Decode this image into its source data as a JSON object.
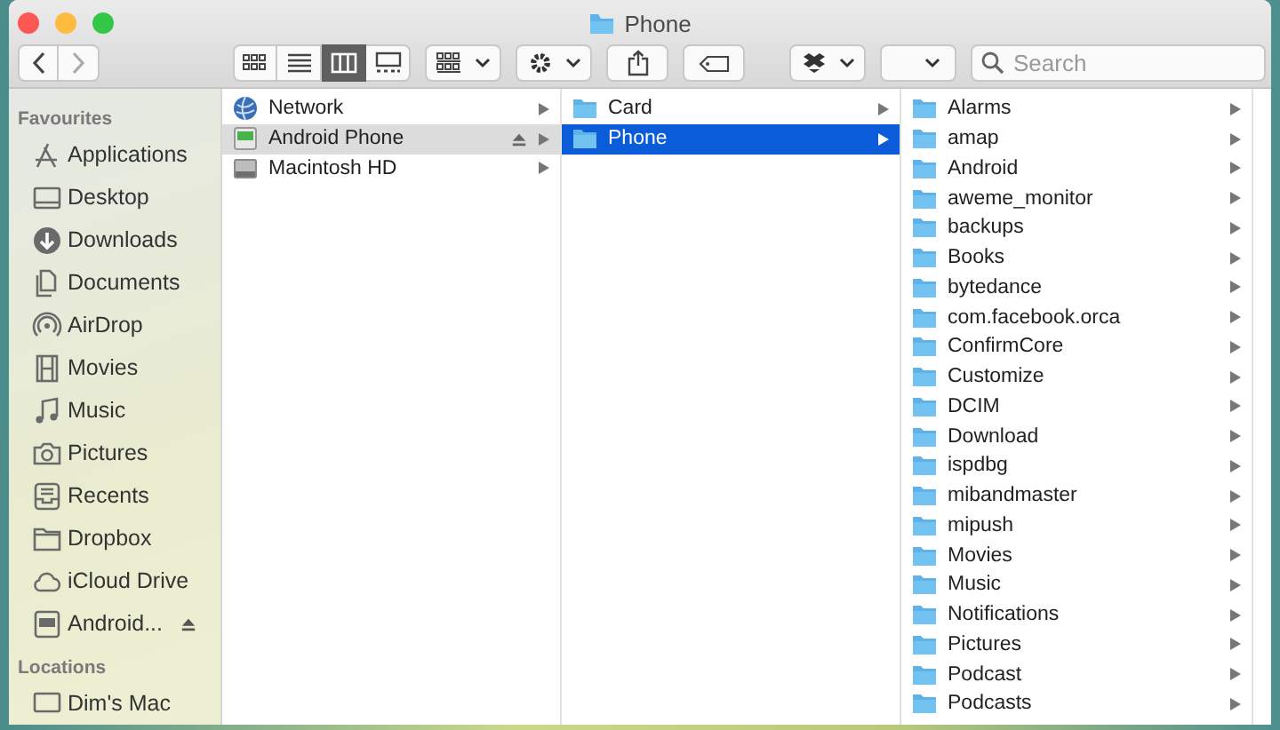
{
  "window": {
    "title": "Phone"
  },
  "toolbar": {
    "view_modes": [
      {
        "kind": "icons",
        "selected": false
      },
      {
        "kind": "list",
        "selected": false
      },
      {
        "kind": "columns",
        "selected": true
      },
      {
        "kind": "gallery",
        "selected": false
      }
    ],
    "search": {
      "placeholder": "Search"
    }
  },
  "sidebar": {
    "sections": [
      {
        "title": "Favourites",
        "items": [
          {
            "label": "Applications",
            "kind": "applications",
            "ejectable": false
          },
          {
            "label": "Desktop",
            "kind": "desktop",
            "ejectable": false
          },
          {
            "label": "Downloads",
            "kind": "downloads",
            "ejectable": false
          },
          {
            "label": "Documents",
            "kind": "documents",
            "ejectable": false
          },
          {
            "label": "AirDrop",
            "kind": "airdrop",
            "ejectable": false
          },
          {
            "label": "Movies",
            "kind": "movies",
            "ejectable": false
          },
          {
            "label": "Music",
            "kind": "music",
            "ejectable": false
          },
          {
            "label": "Pictures",
            "kind": "pictures",
            "ejectable": false
          },
          {
            "label": "Recents",
            "kind": "recents",
            "ejectable": false
          },
          {
            "label": "Dropbox",
            "kind": "folder",
            "ejectable": false
          },
          {
            "label": "iCloud Drive",
            "kind": "cloud",
            "ejectable": false
          },
          {
            "label": "Android...",
            "kind": "drive",
            "ejectable": true
          }
        ]
      },
      {
        "title": "Locations",
        "items": [
          {
            "label": "Dim's Mac",
            "kind": "computer",
            "ejectable": false
          }
        ]
      }
    ]
  },
  "columns": [
    {
      "active": false,
      "items": [
        {
          "label": "Network",
          "kind": "globe",
          "selected": false,
          "ejectable": false
        },
        {
          "label": "Android Phone",
          "kind": "android",
          "selected": true,
          "ejectable": true
        },
        {
          "label": "Macintosh HD",
          "kind": "disk",
          "selected": false,
          "ejectable": false
        }
      ]
    },
    {
      "active": true,
      "items": [
        {
          "label": "Card",
          "kind": "folder",
          "selected": false,
          "ejectable": false
        },
        {
          "label": "Phone",
          "kind": "folder",
          "selected": true,
          "ejectable": false
        }
      ]
    },
    {
      "items": [
        {
          "label": "Alarms",
          "kind": "folder",
          "selected": false,
          "ejectable": false
        },
        {
          "label": "amap",
          "kind": "folder",
          "selected": false,
          "ejectable": false
        },
        {
          "label": "Android",
          "kind": "folder",
          "selected": false,
          "ejectable": false
        },
        {
          "label": "aweme_monitor",
          "kind": "folder",
          "selected": false,
          "ejectable": false
        },
        {
          "label": "backups",
          "kind": "folder",
          "selected": false,
          "ejectable": false
        },
        {
          "label": "Books",
          "kind": "folder",
          "selected": false,
          "ejectable": false
        },
        {
          "label": "bytedance",
          "kind": "folder",
          "selected": false,
          "ejectable": false
        },
        {
          "label": "com.facebook.orca",
          "kind": "folder",
          "selected": false,
          "ejectable": false
        },
        {
          "label": "ConfirmCore",
          "kind": "folder",
          "selected": false,
          "ejectable": false
        },
        {
          "label": "Customize",
          "kind": "folder",
          "selected": false,
          "ejectable": false
        },
        {
          "label": "DCIM",
          "kind": "folder",
          "selected": false,
          "ejectable": false
        },
        {
          "label": "Download",
          "kind": "folder",
          "selected": false,
          "ejectable": false
        },
        {
          "label": "ispdbg",
          "kind": "folder",
          "selected": false,
          "ejectable": false
        },
        {
          "label": "mibandmaster",
          "kind": "folder",
          "selected": false,
          "ejectable": false
        },
        {
          "label": "mipush",
          "kind": "folder",
          "selected": false,
          "ejectable": false
        },
        {
          "label": "Movies",
          "kind": "folder",
          "selected": false,
          "ejectable": false
        },
        {
          "label": "Music",
          "kind": "folder",
          "selected": false,
          "ejectable": false
        },
        {
          "label": "Notifications",
          "kind": "folder",
          "selected": false,
          "ejectable": false
        },
        {
          "label": "Pictures",
          "kind": "folder",
          "selected": false,
          "ejectable": false
        },
        {
          "label": "Podcast",
          "kind": "folder",
          "selected": false,
          "ejectable": false
        },
        {
          "label": "Podcasts",
          "kind": "folder",
          "selected": false,
          "ejectable": false
        }
      ]
    }
  ]
}
